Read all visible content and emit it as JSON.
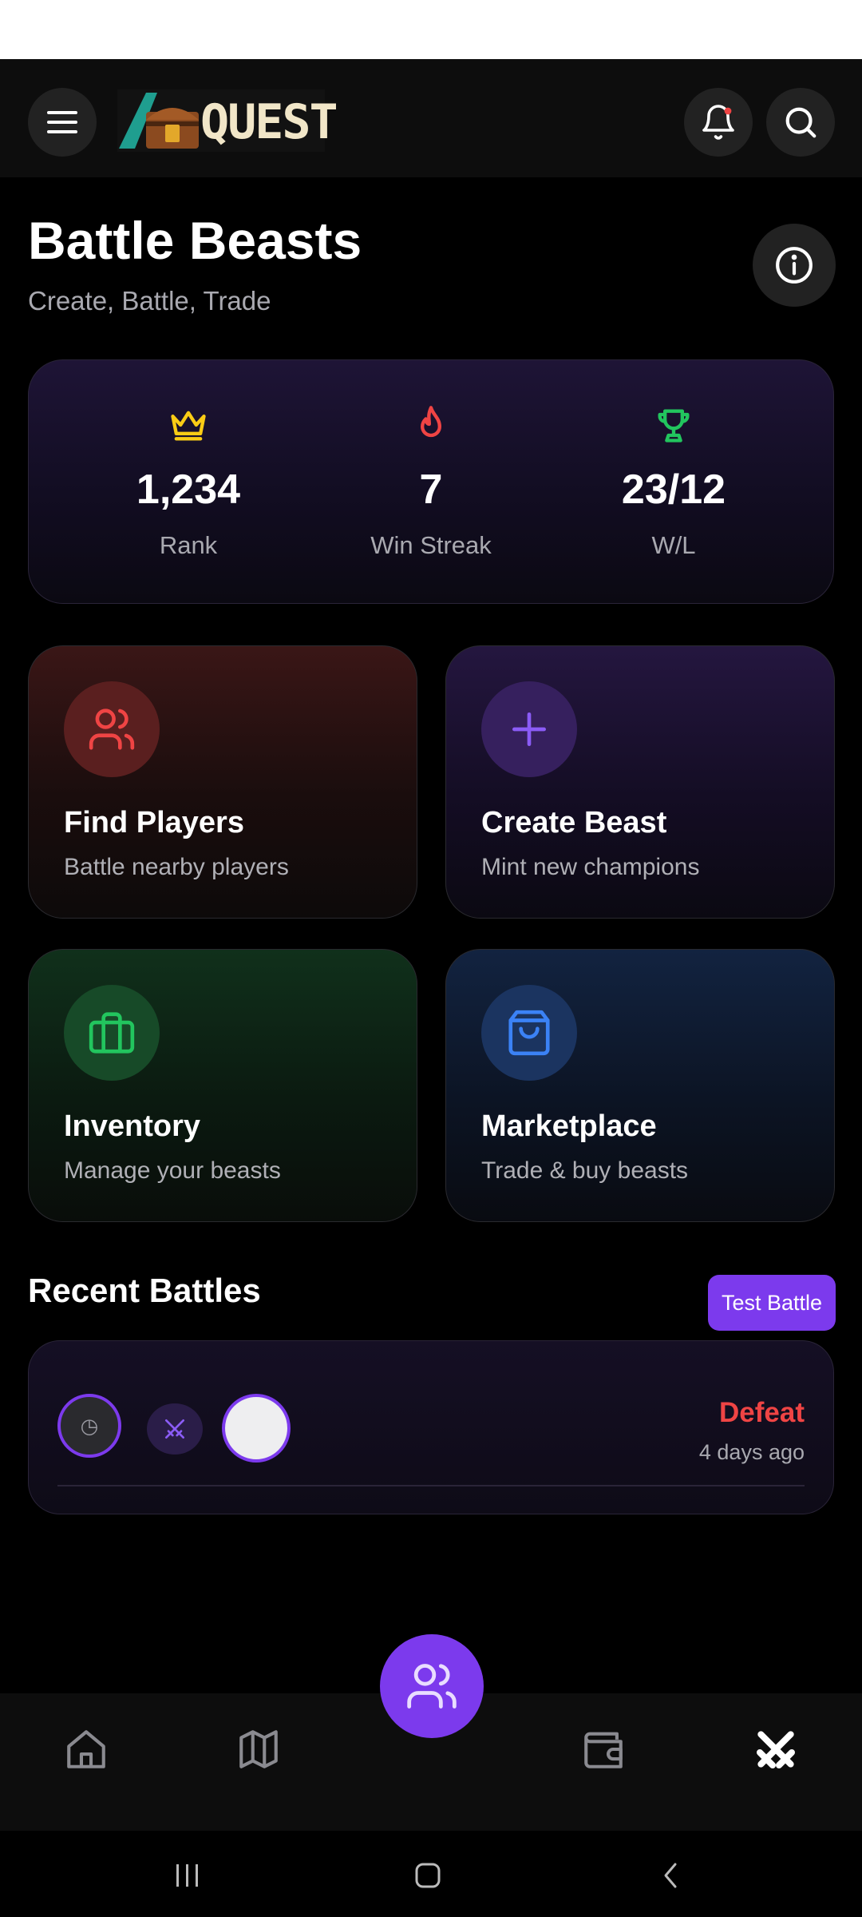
{
  "header": {
    "logo_text": "QUEST",
    "menu_icon": "menu-icon",
    "notification_icon": "bell-icon",
    "search_icon": "search-icon"
  },
  "page": {
    "title": "Battle Beasts",
    "subtitle": "Create, Battle, Trade",
    "info_icon": "info-icon"
  },
  "stats": [
    {
      "icon": "crown-icon",
      "value": "1,234",
      "label": "Rank",
      "color": "#facc15"
    },
    {
      "icon": "flame-icon",
      "value": "7",
      "label": "Win Streak",
      "color": "#ef4444"
    },
    {
      "icon": "trophy-icon",
      "value": "23/12",
      "label": "W/L",
      "color": "#22c55e"
    }
  ],
  "actions": [
    {
      "title": "Find Players",
      "subtitle": "Battle nearby players",
      "icon": "users-icon",
      "color": "#ef4444"
    },
    {
      "title": "Create Beast",
      "subtitle": "Mint new champions",
      "icon": "plus-icon",
      "color": "#8b5cf6"
    },
    {
      "title": "Inventory",
      "subtitle": "Manage your beasts",
      "icon": "briefcase-icon",
      "color": "#22c55e"
    },
    {
      "title": "Marketplace",
      "subtitle": "Trade & buy beasts",
      "icon": "shopping-bag-icon",
      "color": "#3b82f6"
    }
  ],
  "recent": {
    "title": "Recent Battles",
    "test_button": "Test Battle",
    "battles": [
      {
        "result": "Defeat",
        "time": "4 days ago"
      }
    ]
  },
  "nav": {
    "items": [
      "home-icon",
      "map-icon",
      "users-icon",
      "wallet-icon",
      "swords-icon"
    ],
    "active": "swords-icon"
  },
  "colors": {
    "accent": "#7c3aed",
    "defeat": "#ef4444",
    "background": "#000000"
  }
}
